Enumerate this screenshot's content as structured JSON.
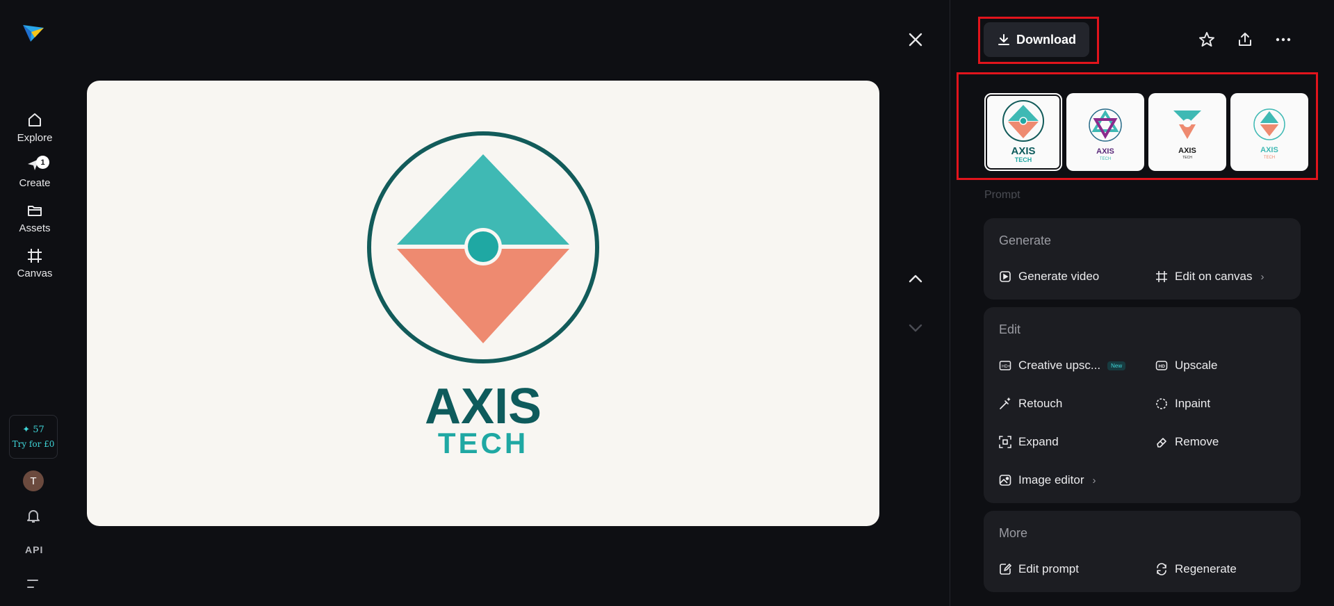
{
  "nav": {
    "items": [
      {
        "label": "Explore",
        "icon": "home-icon"
      },
      {
        "label": "Create",
        "icon": "create-icon",
        "badge": "1"
      },
      {
        "label": "Assets",
        "icon": "folder-icon"
      },
      {
        "label": "Canvas",
        "icon": "canvas-icon"
      }
    ],
    "credits": {
      "count": "✦ 57",
      "cta": "Try for £0"
    },
    "avatar_initial": "T",
    "api_label": "API"
  },
  "image": {
    "brand_main": "AXIS",
    "brand_sub": "TECH"
  },
  "toolbar": {
    "download_label": "Download"
  },
  "thumbnails": [
    {
      "main": "AXIS",
      "sub": "TECH",
      "selected": true
    },
    {
      "main": "AXIS",
      "sub": "TECH",
      "selected": false
    },
    {
      "main": "AXIS",
      "sub": "TECH",
      "selected": false
    },
    {
      "main": "AXIS",
      "sub": "TECH",
      "selected": false
    }
  ],
  "prompt_heading": "Prompt",
  "sections": {
    "generate": {
      "title": "Generate",
      "items": [
        {
          "label": "Generate video",
          "icon": "video-icon"
        },
        {
          "label": "Edit on canvas",
          "icon": "canvas-icon",
          "chevron": "›"
        }
      ]
    },
    "edit": {
      "title": "Edit",
      "items": [
        {
          "label": "Creative upsc...",
          "icon": "hd-plus-icon",
          "tag": "New"
        },
        {
          "label": "Upscale",
          "icon": "hd-icon"
        },
        {
          "label": "Retouch",
          "icon": "magic-wand-icon"
        },
        {
          "label": "Inpaint",
          "icon": "inpaint-icon"
        },
        {
          "label": "Expand",
          "icon": "expand-icon"
        },
        {
          "label": "Remove",
          "icon": "eraser-icon"
        },
        {
          "label": "Image editor",
          "icon": "image-editor-icon",
          "chevron": "›"
        }
      ]
    },
    "more": {
      "title": "More",
      "items": [
        {
          "label": "Edit prompt",
          "icon": "edit-prompt-icon"
        },
        {
          "label": "Regenerate",
          "icon": "regenerate-icon"
        }
      ]
    }
  },
  "colors": {
    "background": "#0e0f13",
    "panel": "#1c1d22",
    "teal": "#3fb9b4",
    "coral": "#ee8a70",
    "brand_dark": "#0e5b5c",
    "highlight": "#e1141c",
    "accent": "#3fd5d8"
  }
}
